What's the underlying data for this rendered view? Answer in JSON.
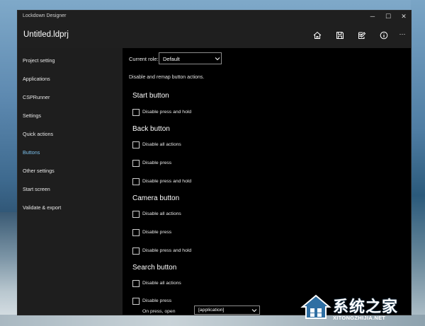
{
  "window": {
    "title": "Lockdown Designer",
    "doc_title": "Untitled.ldprj",
    "controls": {
      "minimize": "─",
      "maximize": "☐",
      "close": "✕"
    },
    "header_icons": [
      "home-icon",
      "save-icon",
      "edit-icon",
      "info-icon",
      "more-icon"
    ],
    "more_label": "···"
  },
  "sidebar": {
    "items": [
      {
        "label": "Project setting",
        "active": false
      },
      {
        "label": "Applications",
        "active": false
      },
      {
        "label": "CSPRunner",
        "active": false
      },
      {
        "label": "Settings",
        "active": false
      },
      {
        "label": "Quick actions",
        "active": false
      },
      {
        "label": "Buttons",
        "active": true
      },
      {
        "label": "Other settings",
        "active": false
      },
      {
        "label": "Start screen",
        "active": false
      },
      {
        "label": "Validate & export",
        "active": false
      }
    ],
    "active_color": "#7cc0ec"
  },
  "main": {
    "role_label": "Current role:",
    "role_value": "Default",
    "description": "Disable and remap button actions.",
    "sections": [
      {
        "title": "Start button",
        "options": [
          "Disable press and hold"
        ]
      },
      {
        "title": "Back button",
        "options": [
          "Disable all actions",
          "Disable press",
          "Disable press and hold"
        ]
      },
      {
        "title": "Camera button",
        "options": [
          "Disable all actions",
          "Disable press",
          "Disable press and hold"
        ]
      },
      {
        "title": "Search button",
        "options": [
          "Disable all actions",
          "Disable press"
        ]
      }
    ],
    "on_press_label": "On press, open",
    "on_press_value": "[application]"
  },
  "watermark": {
    "name": "系统之家",
    "url": "XITONGZHIJIA.NET"
  }
}
